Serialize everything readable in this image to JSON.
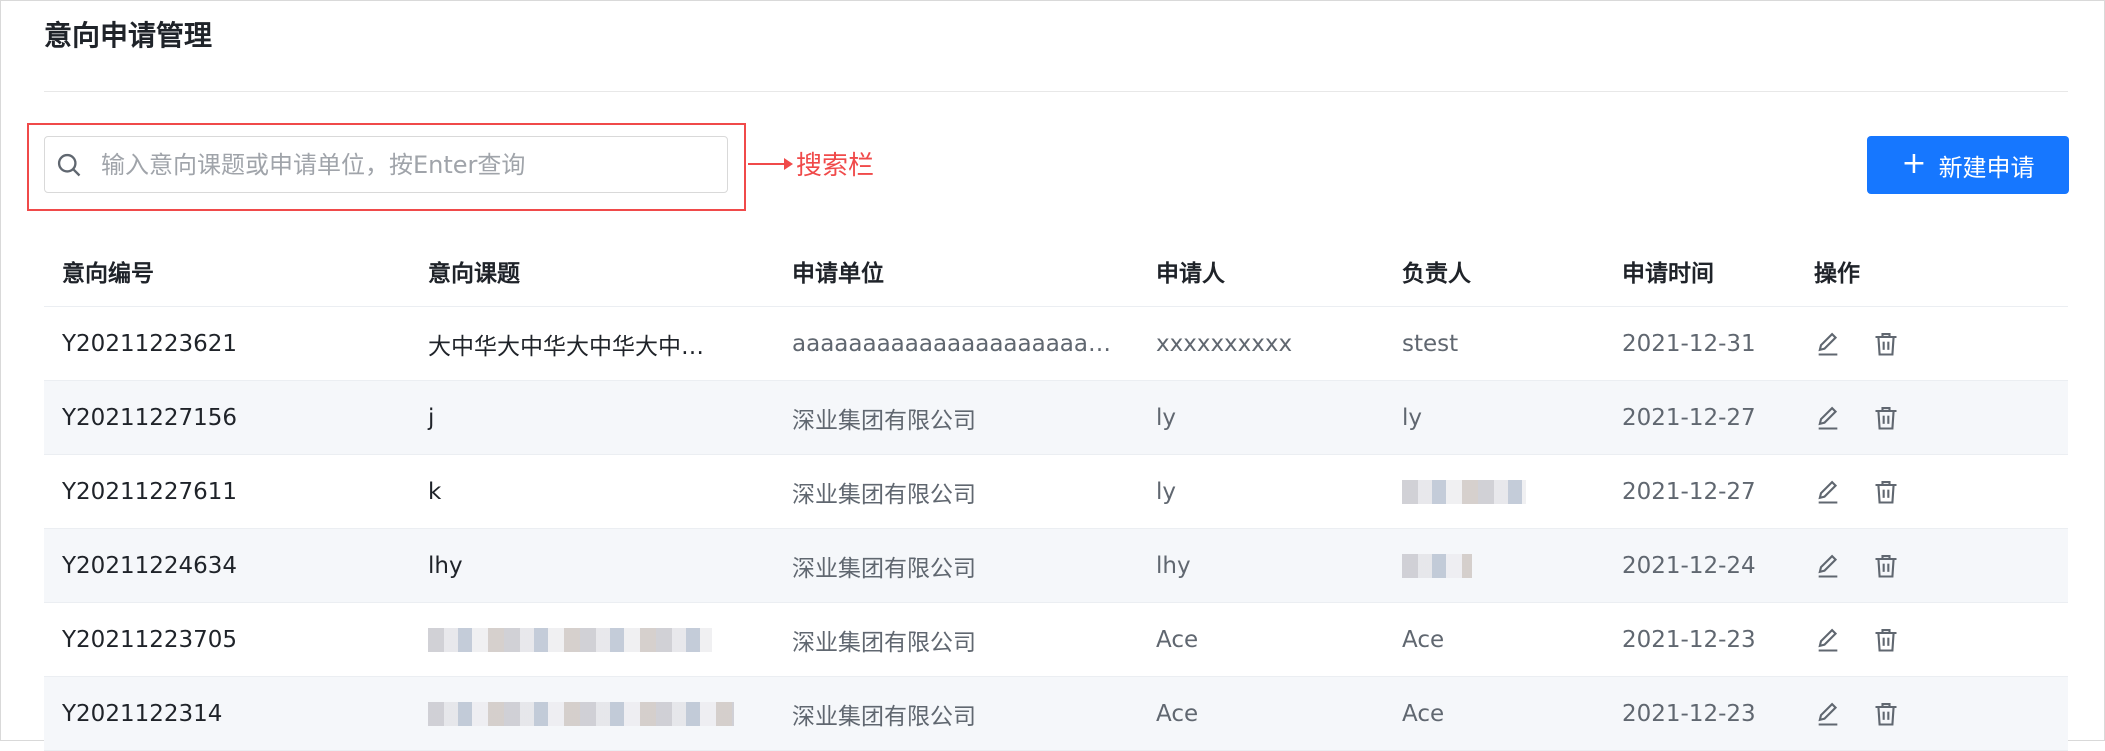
{
  "page": {
    "title": "意向申请管理"
  },
  "search": {
    "placeholder": "输入意向课题或申请单位，按Enter查询",
    "value": "",
    "annotation": "搜索栏"
  },
  "toolbar": {
    "new_button_label": "新建申请",
    "new_button_icon": "plus-icon"
  },
  "colors": {
    "primary": "#1677ff",
    "annotation": "#f04a4a",
    "row_stripe": "#f5f7fa"
  },
  "table": {
    "columns": [
      "意向编号",
      "意向课题",
      "申请单位",
      "申请人",
      "负责人",
      "申请时间",
      "操作"
    ],
    "actions": [
      "edit-icon",
      "trash-icon"
    ],
    "rows": [
      {
        "id": "Y20211223621",
        "title": "大中华大中华大中华大中…",
        "unit": "aaaaaaaaaaaaaaaaaaaaa…",
        "applicant": "xxxxxxxxxx",
        "owner": "stest",
        "date": "2021-12-31"
      },
      {
        "id": "Y20211227156",
        "title": "j",
        "unit": "深业集团有限公司",
        "applicant": "ly",
        "owner": "ly",
        "date": "2021-12-27"
      },
      {
        "id": "Y20211227611",
        "title": "k",
        "unit": "深业集团有限公司",
        "applicant": "ly",
        "owner": "",
        "date": "2021-12-27"
      },
      {
        "id": "Y20211224634",
        "title": "lhy",
        "unit": "深业集团有限公司",
        "applicant": "lhy",
        "owner": "",
        "date": "2021-12-24"
      },
      {
        "id": "Y20211223705",
        "title": "",
        "unit": "深业集团有限公司",
        "applicant": "Ace",
        "owner": "Ace",
        "date": "2021-12-23"
      },
      {
        "id": "Y2021122314",
        "title": "",
        "unit": "深业集团有限公司",
        "applicant": "Ace",
        "owner": "Ace",
        "date": "2021-12-23"
      }
    ]
  }
}
